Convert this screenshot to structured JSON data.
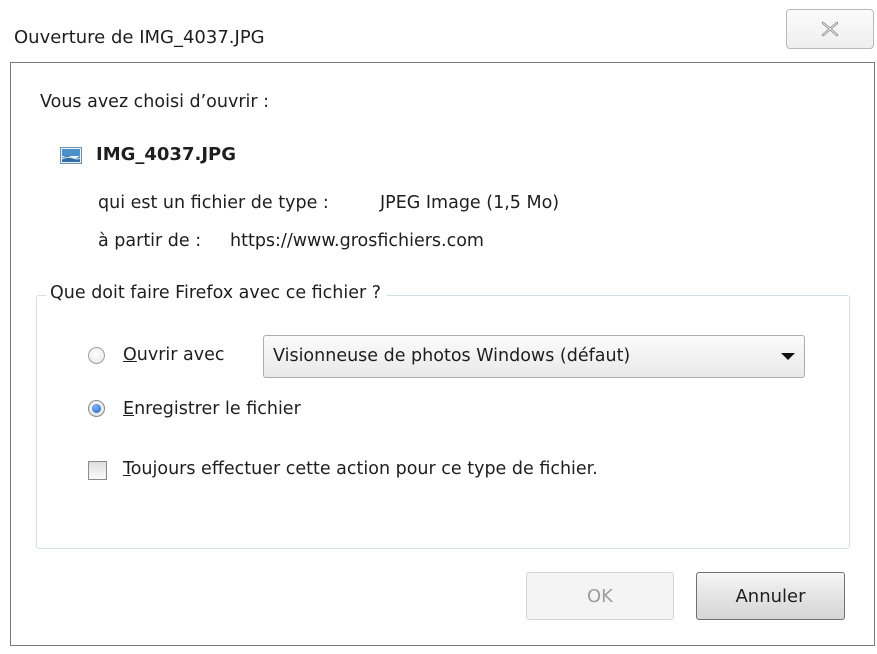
{
  "window": {
    "title": "Ouverture de IMG_4037.JPG"
  },
  "dialog": {
    "prompt": "Vous avez choisi d’ouvrir :",
    "file": {
      "name": "IMG_4037.JPG",
      "icon": "image-file-icon",
      "type_label": "qui est un fichier de type :",
      "type_value": "JPEG Image (1,5 Mo)",
      "source_label": "à partir de :",
      "source_value": "https://www.grosfichiers.com"
    }
  },
  "action_group": {
    "legend": "Que doit faire Firefox avec ce fichier ?",
    "open_with": {
      "label": "Ouvrir avec",
      "selected": false,
      "app": "Visionneuse de photos Windows (défaut)"
    },
    "save_file": {
      "label": "Enregistrer le fichier",
      "selected": true
    },
    "always": {
      "label": "Toujours effectuer cette action pour ce type de fichier.",
      "checked": false
    }
  },
  "buttons": {
    "ok": "OK",
    "cancel": "Annuler"
  },
  "colors": {
    "radio_selected": "#1c5bb8",
    "ok_disabled_text": "#9d9d9d"
  }
}
